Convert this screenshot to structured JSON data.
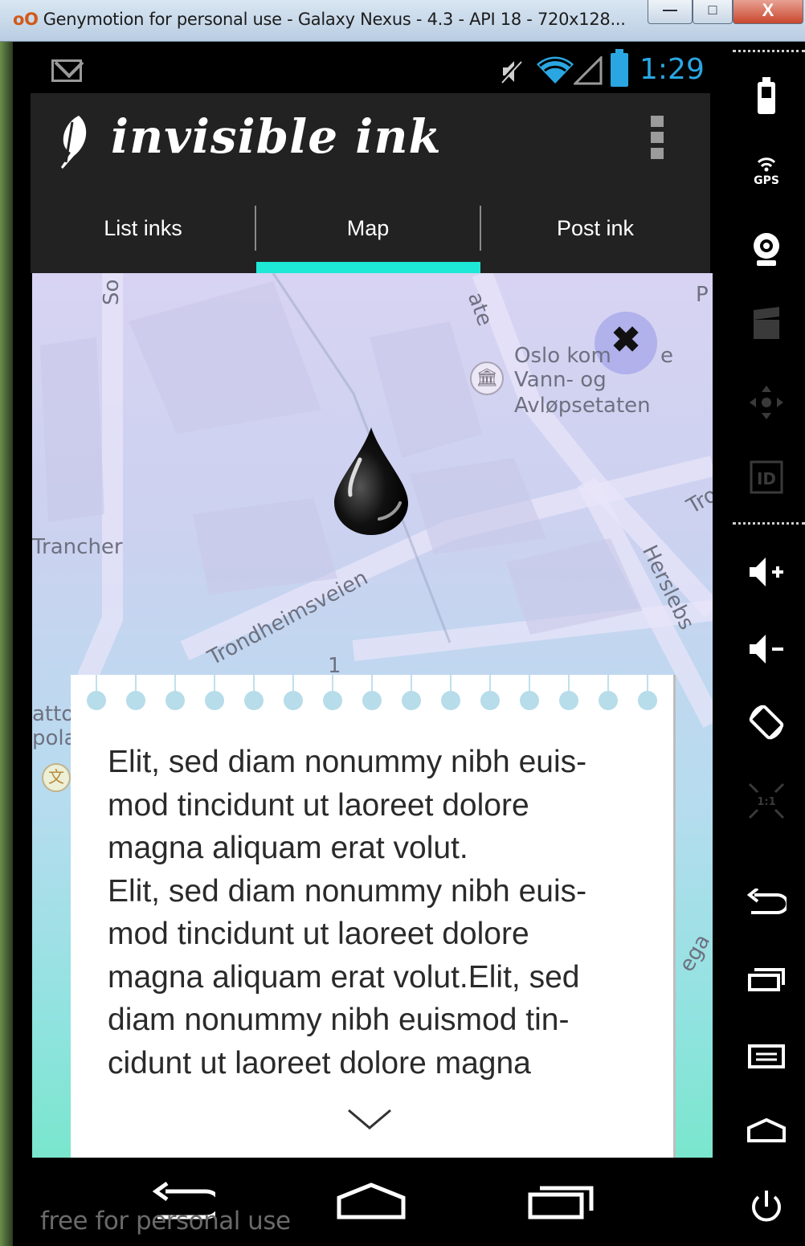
{
  "window": {
    "title": "Genymotion for personal use - Galaxy Nexus - 4.3 - API 18 - 720x128...",
    "app_glyph": "oO",
    "minimize_glyph": "—",
    "maximize_glyph": "□",
    "close_glyph": "X"
  },
  "status_bar": {
    "time": "1:29",
    "notification_icon": "gmail-icon",
    "icons": [
      "mute-icon",
      "wifi-icon",
      "signal-icon",
      "battery-icon"
    ],
    "accent_color": "#2aa7e2"
  },
  "app": {
    "title": "invisible ink",
    "action_bar_color": "#222222"
  },
  "tabs": [
    {
      "label": "List inks",
      "selected": false
    },
    {
      "label": "Map",
      "selected": true
    },
    {
      "label": "Post ink",
      "selected": false
    }
  ],
  "tab_indicator_color": "#1ee8d6",
  "map": {
    "labels": {
      "street_top_left": "So",
      "street_top_right": "P",
      "street_ate": "ate",
      "place_line1": "Oslo kom",
      "place_line1_tail": "e",
      "place_line2": "Vann- og",
      "place_line3": "Avløpsetaten",
      "trancher": "Trancher",
      "trondheimsveien": "Trondheimsveien",
      "herslebs": "Herslebs",
      "tro": "Tro",
      "atto": "atto",
      "pola": "pola",
      "ega": "ega",
      "num": "1"
    },
    "close_glyph": "✖"
  },
  "note": {
    "text_lines": [
      "Elit, sed diam nonummy nibh euis-",
      "mod tincidunt ut laoreet dolore",
      "magna aliquam erat volut.",
      "Elit, sed diam nonummy nibh euis-",
      "mod tincidunt ut laoreet dolore",
      "magna aliquam erat volut.Elit, sed",
      "diam nonummy nibh euismod tin-",
      "cidunt ut laoreet dolore magna"
    ]
  },
  "watermark": "free for personal use",
  "side_panel": {
    "items": [
      {
        "name": "battery-widget-icon",
        "enabled": true
      },
      {
        "name": "gps-icon",
        "label": "GPS",
        "enabled": true
      },
      {
        "name": "webcam-icon",
        "enabled": true
      },
      {
        "name": "screencast-icon",
        "enabled": false
      },
      {
        "name": "dpad-icon",
        "enabled": false
      },
      {
        "name": "device-id-icon",
        "label": "ID",
        "enabled": false
      },
      {
        "name": "volume-up-icon",
        "enabled": true
      },
      {
        "name": "volume-down-icon",
        "enabled": true
      },
      {
        "name": "rotate-icon",
        "enabled": true
      },
      {
        "name": "pixel-perfect-icon",
        "label": "1:1",
        "enabled": false
      },
      {
        "name": "back-icon",
        "enabled": true
      },
      {
        "name": "recent-apps-icon",
        "enabled": true
      },
      {
        "name": "menu-icon",
        "enabled": true
      },
      {
        "name": "home-icon",
        "enabled": true
      },
      {
        "name": "power-icon",
        "enabled": true
      }
    ]
  }
}
